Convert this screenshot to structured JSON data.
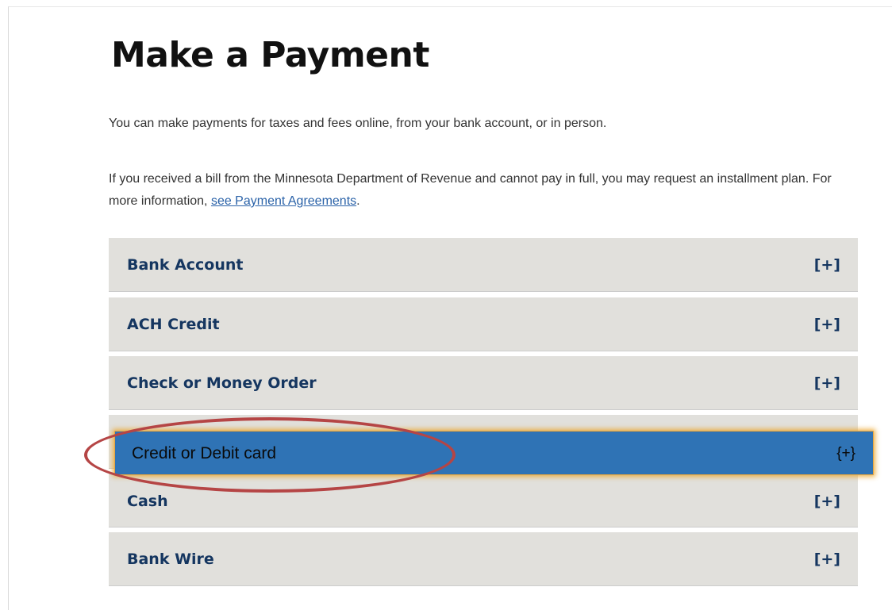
{
  "page": {
    "title": "Make a Payment",
    "intro": "You can make payments for taxes and fees online, from your bank account, or in person.",
    "installment_text": "If you received a bill from the Minnesota Department of Revenue and cannot pay in full, you may request an installment plan. For more information, ",
    "installment_link": "see Payment Agreements",
    "installment_end": "."
  },
  "payment_methods": [
    {
      "label": "Bank Account",
      "toggle": "[+]"
    },
    {
      "label": "ACH Credit",
      "toggle": "[+]"
    },
    {
      "label": "Check or Money Order",
      "toggle": "[+]"
    },
    {
      "label": "Credit or Debit card",
      "toggle": "{+}"
    },
    {
      "label": "Cash",
      "toggle": "[+]"
    },
    {
      "label": "Bank Wire",
      "toggle": "[+]"
    }
  ],
  "colors": {
    "panel_bg": "#e1e0dc",
    "panel_text": "#153660",
    "highlight_bg": "#2f73b5",
    "highlight_glow": "#e8a640",
    "ellipse": "#b54545",
    "link": "#2a62a8"
  }
}
